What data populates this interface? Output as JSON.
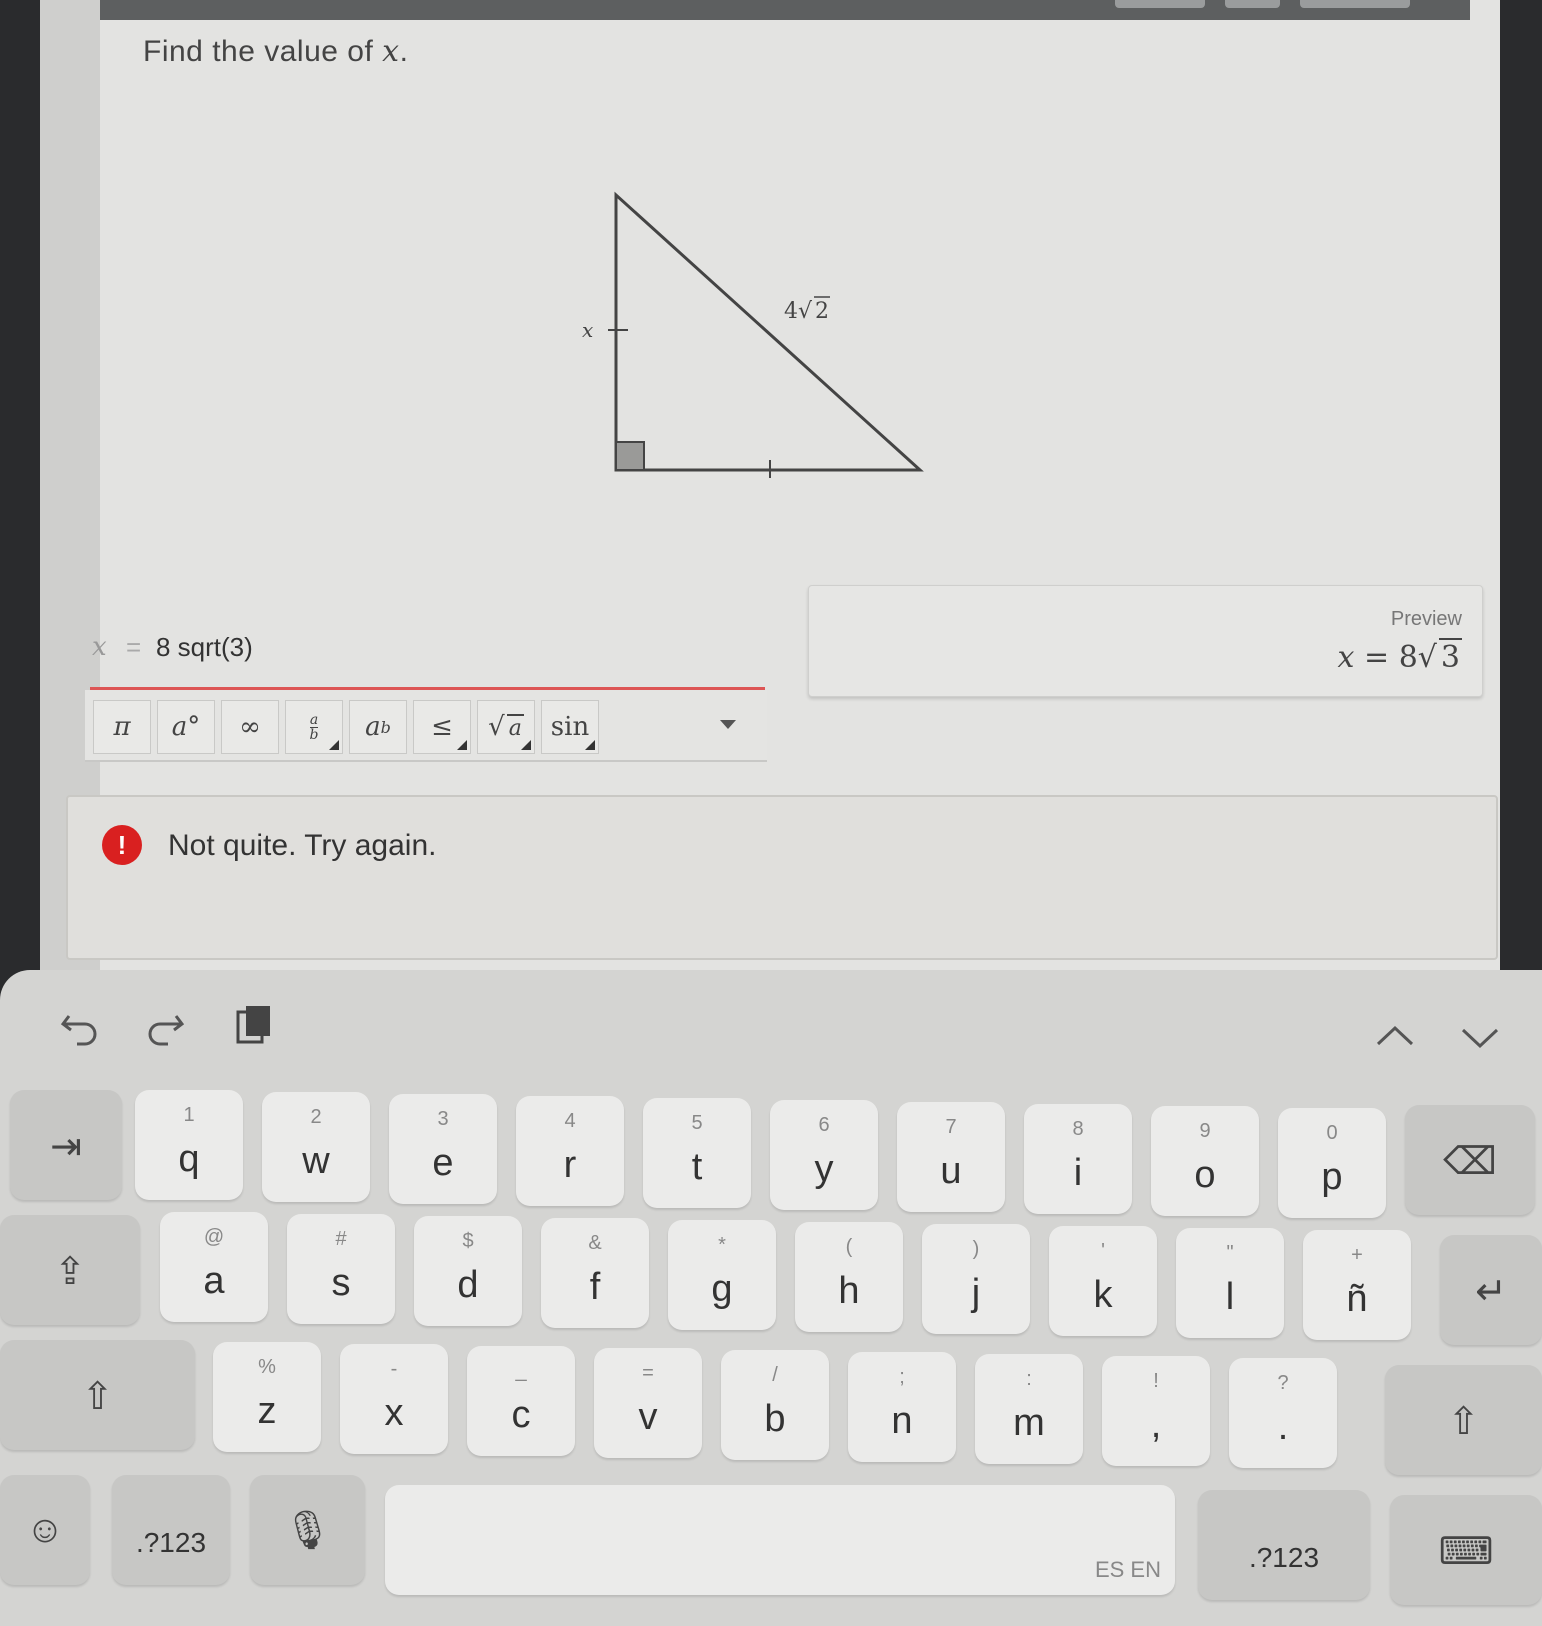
{
  "question": {
    "text_prefix": "Find the value of",
    "variable": "x",
    "text_suffix": "."
  },
  "diagram": {
    "label_x": "x",
    "label_hyp_coef": "4",
    "label_hyp_radicand": "2"
  },
  "answer": {
    "variable": "x",
    "equals": "=",
    "value": "8 sqrt(3)"
  },
  "preview": {
    "label": "Preview",
    "variable": "x",
    "equals": "=",
    "coef": "8",
    "radicand": "3"
  },
  "toolbar": {
    "pi": "π",
    "degree": "a°",
    "infinity": "∞",
    "frac_num": "a",
    "frac_den": "b",
    "power": "a",
    "power_exp": "b",
    "leq": "≤",
    "sqrt": "a",
    "sin": "sin"
  },
  "feedback": {
    "icon": "!",
    "message": "Not quite. Try again."
  },
  "keyboard": {
    "row1": [
      {
        "sub": "1",
        "main": "q"
      },
      {
        "sub": "2",
        "main": "w"
      },
      {
        "sub": "3",
        "main": "e"
      },
      {
        "sub": "4",
        "main": "r"
      },
      {
        "sub": "5",
        "main": "t"
      },
      {
        "sub": "6",
        "main": "y"
      },
      {
        "sub": "7",
        "main": "u"
      },
      {
        "sub": "8",
        "main": "i"
      },
      {
        "sub": "9",
        "main": "o"
      },
      {
        "sub": "0",
        "main": "p"
      }
    ],
    "row2": [
      {
        "sub": "@",
        "main": "a"
      },
      {
        "sub": "#",
        "main": "s"
      },
      {
        "sub": "$",
        "main": "d"
      },
      {
        "sub": "&",
        "main": "f"
      },
      {
        "sub": "*",
        "main": "g"
      },
      {
        "sub": "(",
        "main": "h"
      },
      {
        "sub": ")",
        "main": "j"
      },
      {
        "sub": "'",
        "main": "k"
      },
      {
        "sub": "\"",
        "main": "l"
      },
      {
        "sub": "+",
        "main": "ñ"
      }
    ],
    "row3": [
      {
        "sub": "%",
        "main": "z"
      },
      {
        "sub": "-",
        "main": "x"
      },
      {
        "sub": "_",
        "main": "c"
      },
      {
        "sub": "=",
        "main": "v"
      },
      {
        "sub": "/",
        "main": "b"
      },
      {
        "sub": ";",
        "main": "n"
      },
      {
        "sub": ":",
        "main": "m"
      },
      {
        "sub": "!",
        "main": ","
      },
      {
        "sub": "?",
        "main": "."
      }
    ],
    "symbols_left": ".?123",
    "symbols_right": ".?123",
    "language": "ES EN"
  }
}
